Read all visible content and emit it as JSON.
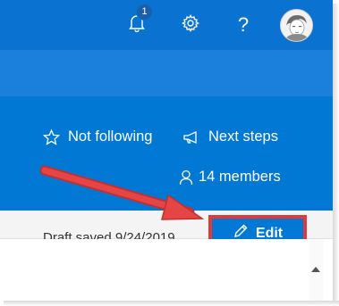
{
  "header": {
    "notification_count": "1",
    "icons": [
      "bell-icon",
      "gear-icon",
      "help-icon",
      "avatar"
    ],
    "help_glyph": "?"
  },
  "group_actions": {
    "follow_label": "Not following",
    "next_steps_label": "Next steps",
    "members_label": "14 members"
  },
  "command_bar": {
    "draft_status": "Draft saved 9/24/2019",
    "edit_label": "Edit"
  },
  "colors": {
    "accent": "#0078d4",
    "header": "#0a73d1",
    "annotation": "#e03a3a"
  }
}
